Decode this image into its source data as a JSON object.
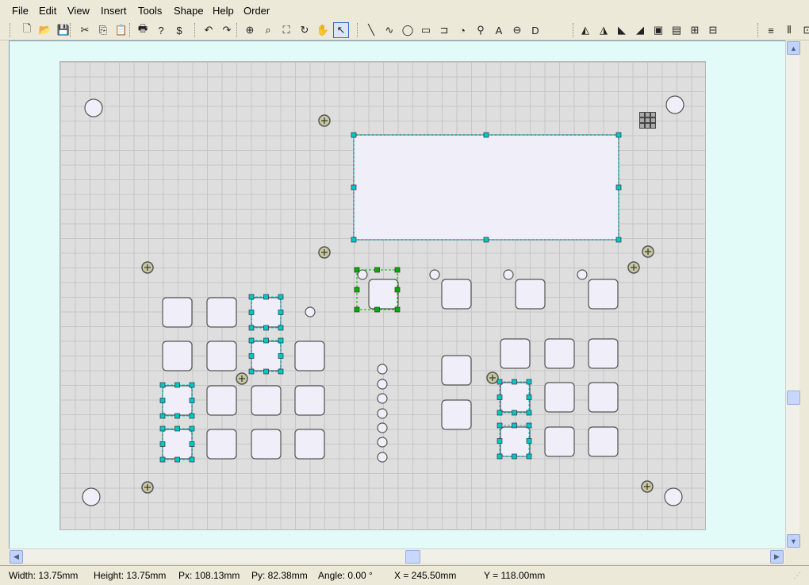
{
  "menu": [
    "File",
    "Edit",
    "View",
    "Insert",
    "Tools",
    "Shape",
    "Help",
    "Order"
  ],
  "toolbar": {
    "file": [
      {
        "name": "new-file-icon",
        "glyph": "🗋"
      },
      {
        "name": "open-folder-icon",
        "glyph": "📂"
      },
      {
        "name": "save-disk-icon",
        "glyph": "💾"
      }
    ],
    "edit": [
      {
        "name": "cut-scissors-icon",
        "glyph": "✂"
      },
      {
        "name": "copy-icon",
        "glyph": "⎘"
      },
      {
        "name": "paste-icon",
        "glyph": "📋"
      }
    ],
    "misc": [
      {
        "name": "print-icon",
        "glyph": "🖶"
      },
      {
        "name": "help-pointer-icon",
        "glyph": "?"
      },
      {
        "name": "price-dollar-icon",
        "glyph": "$"
      }
    ],
    "undo": [
      {
        "name": "undo-icon",
        "glyph": "↶"
      },
      {
        "name": "redo-icon",
        "glyph": "↷"
      }
    ],
    "view": [
      {
        "name": "zoom-in-icon",
        "glyph": "⊕"
      },
      {
        "name": "zoom-window-icon",
        "glyph": "⌕"
      },
      {
        "name": "zoom-fit-icon",
        "glyph": "⛶"
      },
      {
        "name": "refresh-icon",
        "glyph": "↻"
      },
      {
        "name": "pan-hand-icon",
        "glyph": "✋"
      },
      {
        "name": "select-arrow-icon",
        "glyph": "↖"
      }
    ],
    "draw": [
      {
        "name": "line-tool-icon",
        "glyph": "╲"
      },
      {
        "name": "curve-tool-icon",
        "glyph": "∿"
      },
      {
        "name": "ellipse-tool-icon",
        "glyph": "◯"
      },
      {
        "name": "rectangle-tool-icon",
        "glyph": "▭"
      },
      {
        "name": "rounded-rect-tool-icon",
        "glyph": "⊐"
      },
      {
        "name": "circle-arc-tool-icon",
        "glyph": "◔"
      },
      {
        "name": "thread-tool-icon",
        "glyph": "⚲"
      },
      {
        "name": "text-tool-icon",
        "glyph": "A"
      },
      {
        "name": "slot-tool-icon",
        "glyph": "⊖"
      },
      {
        "name": "d-shape-tool-icon",
        "glyph": "D"
      }
    ],
    "arrange": [
      {
        "name": "mirror-horizontal-icon",
        "glyph": "◭"
      },
      {
        "name": "flip-icon",
        "glyph": "◮"
      },
      {
        "name": "rotate-left-icon",
        "glyph": "◣"
      },
      {
        "name": "rotate-right-icon",
        "glyph": "◢"
      },
      {
        "name": "bring-front-icon",
        "glyph": "▣"
      },
      {
        "name": "send-back-icon",
        "glyph": "▤"
      },
      {
        "name": "group-icon",
        "glyph": "⊞"
      },
      {
        "name": "ungroup-icon",
        "glyph": "⊟"
      }
    ],
    "align": [
      {
        "name": "align-center-icon",
        "glyph": "≡"
      },
      {
        "name": "distribute-icon",
        "glyph": "⦀"
      },
      {
        "name": "align-middle-icon",
        "glyph": "⊡"
      }
    ]
  },
  "status": {
    "width": "Width: 13.75mm",
    "height": "Height: 13.75mm",
    "px": "Px: 108.13mm",
    "py": "Py: 82.38mm",
    "angle": "Angle: 0.00 °",
    "x": "X = 245.50mm",
    "y": "Y = 118.00mm"
  },
  "colors": {
    "selection": "#00c8c8",
    "active_selection": "#00b000",
    "cutout_fill": "#f0eef8",
    "screw_fill": "#c8c8a0",
    "panel": "#dedede",
    "workspace": "#e3fbf8"
  }
}
